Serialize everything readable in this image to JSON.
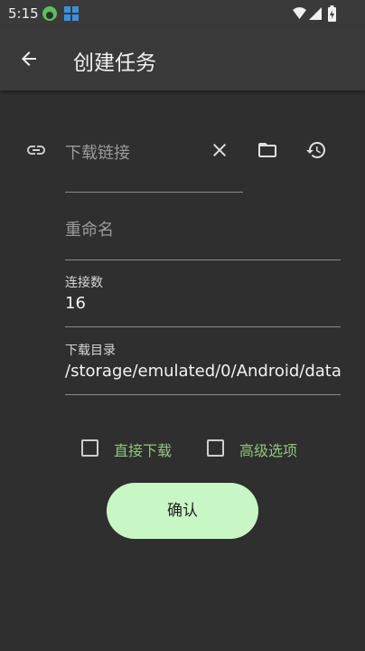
{
  "status_bar": {
    "time": "5:15"
  },
  "app_bar": {
    "title": "创建任务"
  },
  "form": {
    "download_link": {
      "placeholder": "下载链接"
    },
    "rename": {
      "placeholder": "重命名"
    },
    "connections": {
      "label": "连接数",
      "value": "16"
    },
    "download_dir": {
      "label": "下载目录",
      "value": "/storage/emulated/0/Android/data/"
    }
  },
  "options": {
    "direct_download": {
      "label": "直接下载",
      "checked": false
    },
    "advanced_options": {
      "label": "高级选项",
      "checked": false
    }
  },
  "actions": {
    "confirm_label": "确认"
  },
  "colors": {
    "background": "#2f2f2f",
    "app_bar": "#3a3a3a",
    "accent_label": "#93c47d",
    "confirm_button": "#c8f7c5"
  },
  "icons": [
    "back-arrow-icon",
    "link-icon",
    "clear-icon",
    "folder-icon",
    "history-icon",
    "wifi-icon",
    "signal-icon",
    "battery-icon",
    "app-notification-icon",
    "grid-notification-icon"
  ]
}
